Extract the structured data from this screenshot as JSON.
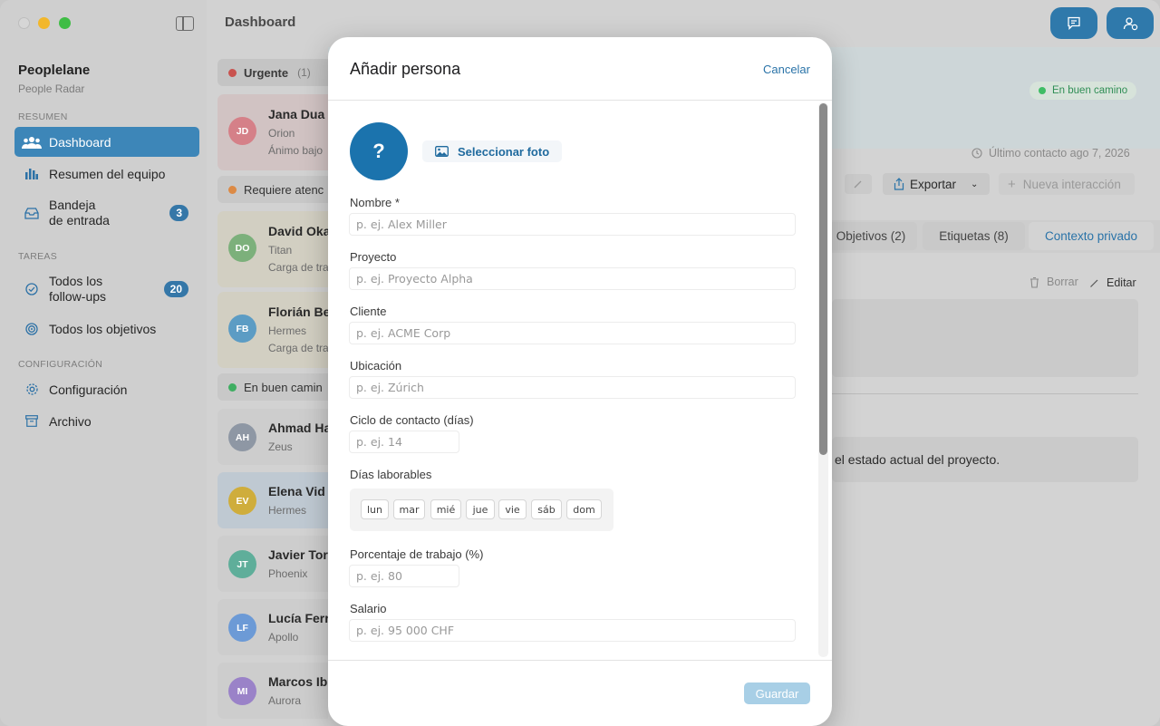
{
  "sidebar": {
    "app_name": "Peoplelane",
    "app_subtitle": "People Radar",
    "sections": {
      "summary": "RESUMEN",
      "tasks": "TAREAS",
      "config": "CONFIGURACIÓN"
    },
    "items": [
      {
        "label": "Dashboard",
        "icon": "people-icon"
      },
      {
        "label": "Resumen del equipo",
        "icon": "bar-chart-icon"
      },
      {
        "label": "Bandeja\nde entrada",
        "icon": "inbox-icon",
        "badge": "3"
      },
      {
        "label": "Todos los\nfollow-ups",
        "icon": "check-circle-icon",
        "badge": "20"
      },
      {
        "label": "Todos los objetivos",
        "icon": "target-icon"
      },
      {
        "label": "Configuración",
        "icon": "gear-icon"
      },
      {
        "label": "Archivo",
        "icon": "archive-icon"
      }
    ]
  },
  "header": {
    "title": "Dashboard"
  },
  "groups": {
    "urgent": {
      "label": "Urgente",
      "count": "(1)"
    },
    "attention": {
      "label": "Requiere atenc"
    },
    "ontrack": {
      "label": "En buen camin"
    }
  },
  "people": [
    {
      "initials": "JD",
      "name": "Jana Dua",
      "project": "Orion",
      "note": "Ánimo bajo",
      "color": "#d77f86"
    },
    {
      "initials": "DO",
      "name": "David Oka",
      "project": "Titan",
      "note": "Carga de tra",
      "color": "#7cb07b"
    },
    {
      "initials": "FB",
      "name": "Florián Be",
      "project": "Hermes",
      "note": "Carga de tra",
      "color": "#5c9cc4"
    },
    {
      "initials": "AH",
      "name": "Ahmad Ha",
      "project": "Zeus",
      "note": "",
      "color": "#8e97a4"
    },
    {
      "initials": "EV",
      "name": "Elena Vid",
      "project": "Hermes",
      "note": "",
      "color": "#cfad3c"
    },
    {
      "initials": "JT",
      "name": "Javier Tor",
      "project": "Phoenix",
      "note": "",
      "color": "#5fae9a"
    },
    {
      "initials": "LF",
      "name": "Lucía Ferr",
      "project": "Apollo",
      "note": "",
      "color": "#6c9ad6"
    },
    {
      "initials": "MI",
      "name": "Marcos Ib",
      "project": "Aurora",
      "note": "",
      "color": "#9a82c8"
    }
  ],
  "detail": {
    "status": "En buen camino",
    "last_contact": "Último contacto ago 7, 2026",
    "export": "Exportar",
    "new_interaction": "Nueva interacción",
    "tabs": [
      "Objetivos (2)",
      "Etiquetas (8)",
      "Contexto privado"
    ],
    "delete": "Borrar",
    "edit": "Editar",
    "note_text": "el estado actual del proyecto."
  },
  "modal": {
    "title": "Añadir persona",
    "cancel": "Cancelar",
    "photo_placeholder": "?",
    "select_photo": "Seleccionar foto",
    "fields": {
      "name": {
        "label": "Nombre *",
        "placeholder": "p. ej. Alex Miller"
      },
      "project": {
        "label": "Proyecto",
        "placeholder": "p. ej. Proyecto Alpha"
      },
      "client": {
        "label": "Cliente",
        "placeholder": "p. ej. ACME Corp"
      },
      "location": {
        "label": "Ubicación",
        "placeholder": "p. ej. Zúrich"
      },
      "cycle": {
        "label": "Ciclo de contacto (días)",
        "placeholder": "p. ej. 14"
      },
      "workdays": {
        "label": "Días laborables"
      },
      "percent": {
        "label": "Porcentaje de trabajo (%)",
        "placeholder": "p. ej. 80"
      },
      "salary": {
        "label": "Salario",
        "placeholder": "p. ej. 95 000 CHF"
      }
    },
    "days": [
      "lun",
      "mar",
      "mié",
      "jue",
      "vie",
      "sáb",
      "dom"
    ],
    "save": "Guardar"
  },
  "colors": {
    "accent": "#2f79ab",
    "urgent": "#d9534f",
    "attention": "#e08a3c",
    "ontrack": "#3fbd65"
  }
}
